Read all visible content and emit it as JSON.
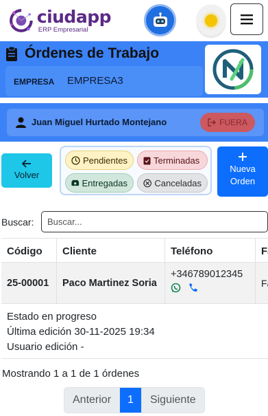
{
  "header": {
    "logo_name": "ciudapp",
    "logo_sub": "ERP Empresarial"
  },
  "banner": {
    "title": "Órdenes de Trabajo",
    "empresa_label": "EMPRESA",
    "empresa_value": "EMPRESA3"
  },
  "user": {
    "name": "Juan Miguel Hurtado Montejano",
    "logout_label": "FUERA"
  },
  "actions": {
    "back_label": "Volver",
    "new_label_1": "Nueva",
    "new_label_2": "Orden"
  },
  "filters": {
    "pending": "Pendientes",
    "finished": "Terminadas",
    "delivered": "Entregadas",
    "cancelled": "Canceladas"
  },
  "search": {
    "label": "Buscar:",
    "placeholder": "Buscar..."
  },
  "table": {
    "columns": [
      "Código",
      "Cliente",
      "Teléfono",
      "Fa"
    ],
    "rows": [
      {
        "codigo": "25-00001",
        "cliente": "Paco Martinez Soria",
        "telefono": "+346789012345",
        "fa": "Fa",
        "estado": "Estado en progreso",
        "ultima_edicion": "Última edición 30-11-2025 19:34",
        "usuario_edicion": "Usuario edición -"
      }
    ]
  },
  "footer": {
    "info": "Mostrando 1 a 1 de 1 órdenes",
    "prev": "Anterior",
    "page": "1",
    "next": "Siguiente"
  },
  "colors": {
    "banner_blue": "#3b82f6",
    "primary": "#0d6efd",
    "back_button": "#1ec6e8",
    "logout_red": "#d9534f"
  },
  "icons": [
    "ciudapp-logo-icon",
    "robot-icon",
    "sun-icon",
    "menu-icon",
    "clipboard-icon",
    "company-logo-icon",
    "user-icon",
    "logout-icon",
    "arrow-left-icon",
    "plus-icon",
    "clock-icon",
    "clipboard-check-icon",
    "money-icon",
    "cancel-circle-icon",
    "whatsapp-icon",
    "phone-icon"
  ]
}
